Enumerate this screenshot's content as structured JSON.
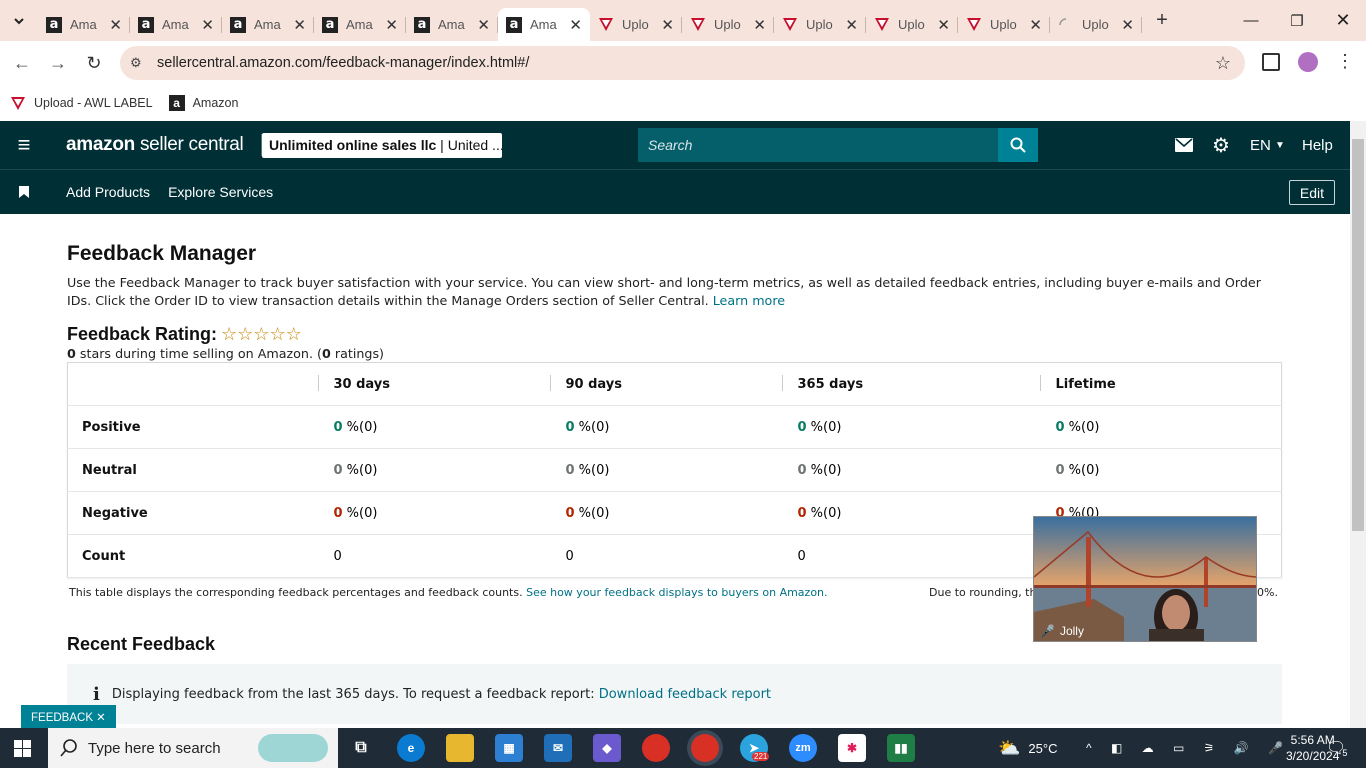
{
  "browser": {
    "tabs": [
      {
        "title": "Ama",
        "icon": "amazon-icon",
        "active": false
      },
      {
        "title": "Ama",
        "icon": "amazon-icon",
        "active": false
      },
      {
        "title": "Ama",
        "icon": "amazon-icon",
        "active": false
      },
      {
        "title": "Ama",
        "icon": "amazon-icon",
        "active": false
      },
      {
        "title": "Ama",
        "icon": "amazon-icon",
        "active": false
      },
      {
        "title": "Ama",
        "icon": "amazon-icon",
        "active": true
      },
      {
        "title": "Uplo",
        "icon": "upload-icon",
        "active": false
      },
      {
        "title": "Uplo",
        "icon": "upload-icon",
        "active": false
      },
      {
        "title": "Uplo",
        "icon": "upload-icon",
        "active": false
      },
      {
        "title": "Uplo",
        "icon": "upload-icon",
        "active": false
      },
      {
        "title": "Uplo",
        "icon": "upload-icon",
        "active": false
      },
      {
        "title": "Uplo",
        "icon": "loading-icon",
        "active": false
      }
    ],
    "url": "sellercentral.amazon.com/feedback-manager/index.html#/",
    "bookmarks": [
      {
        "label": "Upload - AWL LABEL",
        "icon": "upload-icon"
      },
      {
        "label": "Amazon",
        "icon": "amazon-icon"
      }
    ]
  },
  "header": {
    "logo_amazon": "amazon",
    "logo_rest": "seller central",
    "account_name": "Unlimited online sales llc",
    "account_region": "United ...",
    "search_placeholder": "Search",
    "language": "EN",
    "help": "Help"
  },
  "subnav": {
    "links": [
      "Add Products",
      "Explore Services"
    ],
    "edit": "Edit"
  },
  "main": {
    "title": "Feedback Manager",
    "description": "Use the Feedback Manager to track buyer satisfaction with your service. You can view short- and long-term metrics, as well as detailed feedback entries, including buyer e-mails and Order IDs. Click the Order ID to view transaction details within the Manage Orders section of Seller Central.",
    "learn_more": "Learn more",
    "rating_title": "Feedback Rating:",
    "stars": "☆☆☆☆☆",
    "rating_sub_stars": "0",
    "rating_sub_text1": " stars during time selling on Amazon. (",
    "rating_sub_ratings": "0",
    "rating_sub_text2": " ratings)",
    "table": {
      "headers": [
        "30 days",
        "90 days",
        "365 days",
        "Lifetime"
      ],
      "rows": [
        {
          "label": "Positive",
          "kind": "pos",
          "cells": [
            {
              "v": "0",
              "p": " %(0)"
            },
            {
              "v": "0",
              "p": " %(0)"
            },
            {
              "v": "0",
              "p": " %(0)"
            },
            {
              "v": "0",
              "p": " %(0)"
            }
          ]
        },
        {
          "label": "Neutral",
          "kind": "neu",
          "cells": [
            {
              "v": "0",
              "p": " %(0)"
            },
            {
              "v": "0",
              "p": " %(0)"
            },
            {
              "v": "0",
              "p": " %(0)"
            },
            {
              "v": "0",
              "p": " %(0)"
            }
          ]
        },
        {
          "label": "Negative",
          "kind": "neg",
          "cells": [
            {
              "v": "0",
              "p": " %(0)"
            },
            {
              "v": "0",
              "p": " %(0)"
            },
            {
              "v": "0",
              "p": " %(0)"
            },
            {
              "v": "0",
              "p": " %(0)"
            }
          ]
        },
        {
          "label": "Count",
          "kind": "count",
          "cells": [
            {
              "v": "0",
              "p": ""
            },
            {
              "v": "0",
              "p": ""
            },
            {
              "v": "0",
              "p": ""
            },
            {
              "v": "",
              "p": ""
            }
          ]
        }
      ]
    },
    "table_note": "This table displays the corresponding feedback percentages and feedback counts.",
    "table_note_link": "See how your feedback displays to buyers on Amazon.",
    "rounding_note_start": "Due to rounding, th",
    "rounding_note_end": "0%.",
    "recent_title": "Recent Feedback",
    "info_text": "Displaying feedback from the last 365 days. To request a feedback report:",
    "info_link": "Download feedback report",
    "feedback_tab": "FEEDBACK ✕"
  },
  "video": {
    "name": "Jolly"
  },
  "taskbar": {
    "search": "Type here to search",
    "weather": "25°C",
    "time": "5:56 AM",
    "date": "3/20/2024",
    "telegram_badge": "221",
    "notifications": "5"
  },
  "colors": {
    "header_bg": "#002f36",
    "link": "#007185",
    "positive": "#067d62",
    "negative": "#b12704",
    "neutral": "#6f7373"
  }
}
